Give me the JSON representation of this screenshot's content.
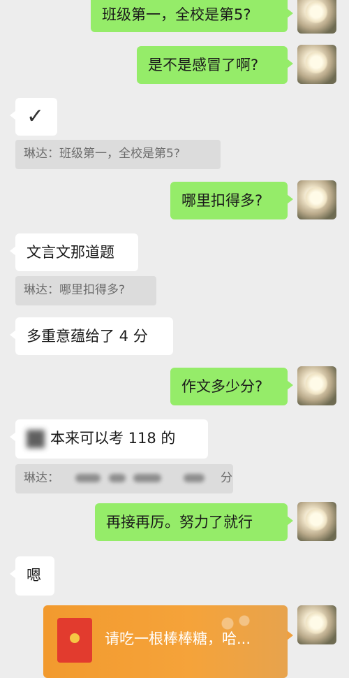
{
  "messages": [
    {
      "text": "班级第一，全校是第5?"
    },
    {
      "text": "是不是感冒了啊?"
    },
    {
      "text": "✓"
    },
    {
      "text": "琳达：班级第一，全校是第5?"
    },
    {
      "text": "哪里扣得多?"
    },
    {
      "text": "文言文那道题"
    },
    {
      "text": "琳达：哪里扣得多?"
    },
    {
      "text": "多重意蕴给了 4 分"
    },
    {
      "text": "作文多少分?"
    },
    {
      "text": "本来可以考 118 的"
    },
    {
      "quote_prefix": "琳达：",
      "quote_suffix": "分"
    },
    {
      "text": "再接再厉。努力了就行"
    },
    {
      "text": "嗯"
    }
  ],
  "red_packet": {
    "text": "请吃一根棒棒糖，哈..."
  }
}
